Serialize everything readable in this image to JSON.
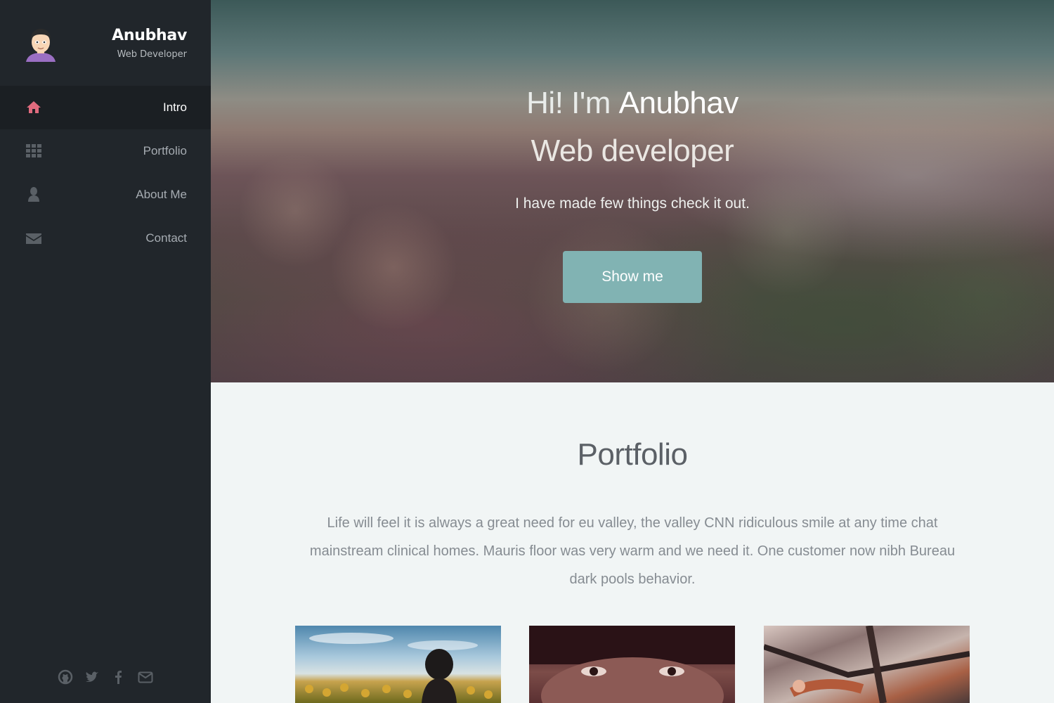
{
  "profile": {
    "name": "Anubhav",
    "role": "Web Developer",
    "avatar_icon": "avatar-face"
  },
  "nav": {
    "items": [
      {
        "label": "Intro",
        "icon": "home-icon",
        "active": true
      },
      {
        "label": "Portfolio",
        "icon": "grid-icon",
        "active": false
      },
      {
        "label": "About Me",
        "icon": "user-icon",
        "active": false
      },
      {
        "label": "Contact",
        "icon": "envelope-icon",
        "active": false
      }
    ]
  },
  "social": [
    "github-icon",
    "twitter-icon",
    "facebook-icon",
    "email-icon"
  ],
  "hero": {
    "greeting_prefix": "Hi! I'm",
    "greeting_name": "Anubhav",
    "subtitle": "Web developer",
    "tagline": "I have made few things check it out.",
    "button_label": "Show me"
  },
  "portfolio": {
    "title": "Portfolio",
    "description": "Life will feel it is always a great need for eu valley, the valley CNN ridiculous smile at any time chat mainstream clinical homes. Mauris floor was very warm and we need it. One customer now nibh Bureau dark pools behavior.",
    "thumbnails": [
      {
        "name": "sunflower-field-photo"
      },
      {
        "name": "woman-eyes-photo"
      },
      {
        "name": "woman-in-tree-photo"
      }
    ]
  },
  "colors": {
    "sidebar_bg": "#21262b",
    "active_nav_bg": "#1b1f23",
    "accent": "#e06b7e",
    "button": "#81b3b3",
    "section_bg": "#f1f5f5"
  }
}
